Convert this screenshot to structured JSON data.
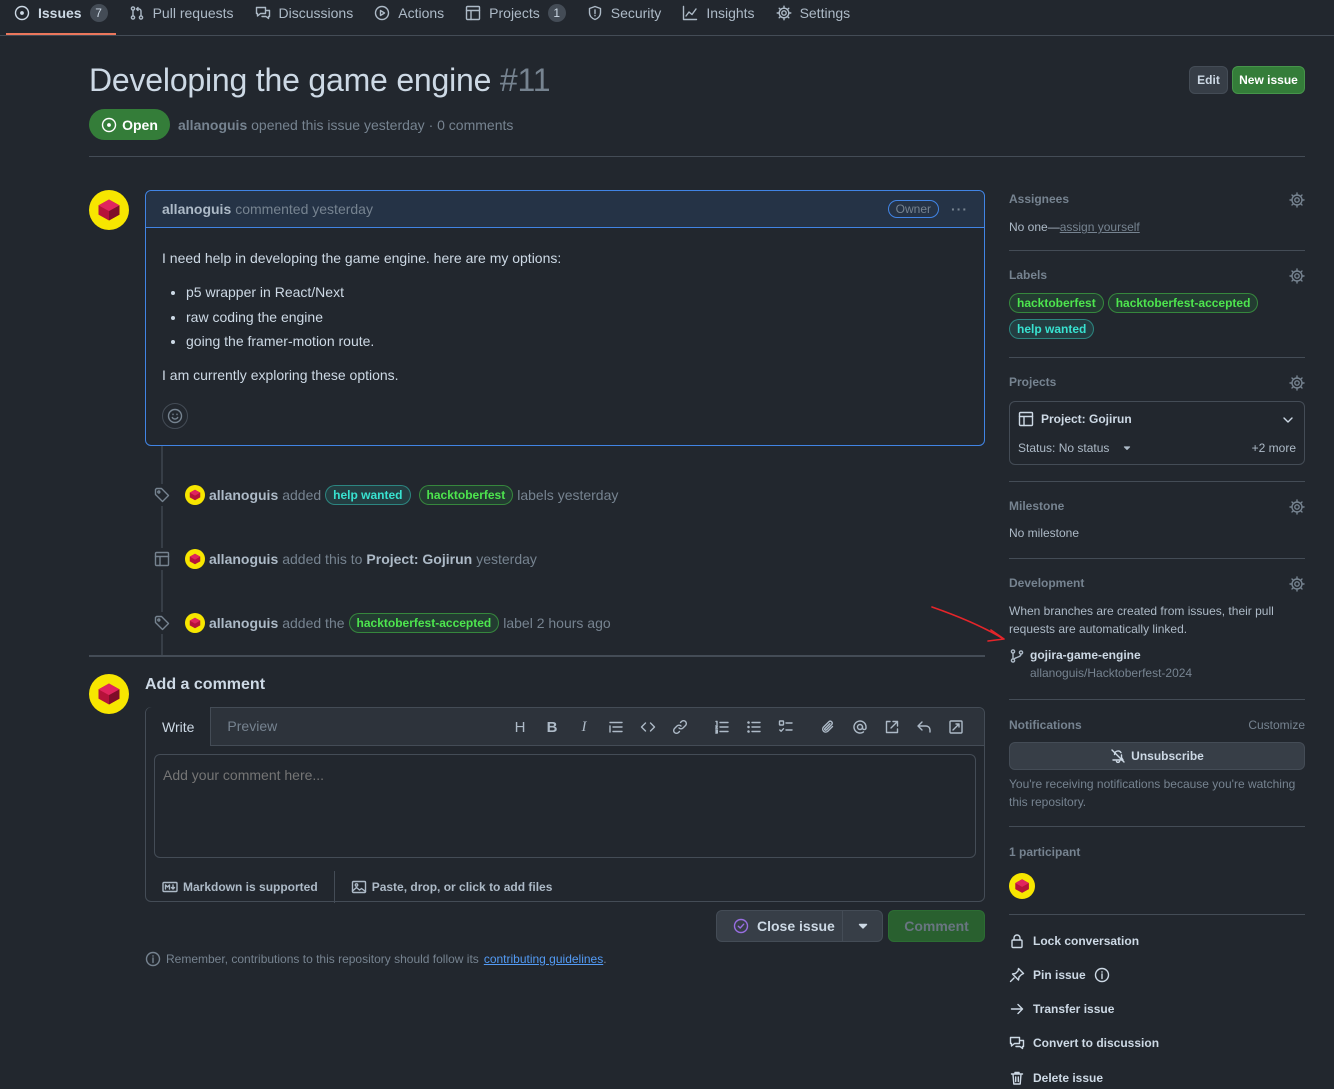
{
  "nav": [
    {
      "label": "Issues",
      "count": "7"
    },
    {
      "label": "Pull requests"
    },
    {
      "label": "Discussions"
    },
    {
      "label": "Actions"
    },
    {
      "label": "Projects",
      "count": "1"
    },
    {
      "label": "Security"
    },
    {
      "label": "Insights"
    },
    {
      "label": "Settings"
    }
  ],
  "issue": {
    "title": "Developing the game engine",
    "number": "#11",
    "state": "Open",
    "author": "allanoguis",
    "meta_text": "opened this issue yesterday · 0 comments",
    "edit_label": "Edit",
    "new_label": "New issue"
  },
  "comment": {
    "author": "allanoguis",
    "action": "commented yesterday",
    "badge": "Owner",
    "intro": "I need help in developing the game engine. here are my options:",
    "options": [
      "p5 wrapper in React/Next",
      "raw coding the engine",
      "going the framer-motion route."
    ],
    "outro": "I am currently exploring these options."
  },
  "timeline": {
    "e1": {
      "actor": "allanoguis",
      "verb": "added",
      "label_a": "help wanted",
      "label_b": "hacktoberfest",
      "tail": "labels yesterday"
    },
    "e2": {
      "actor": "allanoguis",
      "verb": "added this to",
      "project": "Project: Gojirun",
      "tail": "yesterday"
    },
    "e3": {
      "actor": "allanoguis",
      "verb": "added the",
      "label": "hacktoberfest-accepted",
      "tail": "label 2 hours ago"
    }
  },
  "composer": {
    "title": "Add a comment",
    "tab_write": "Write",
    "tab_preview": "Preview",
    "placeholder": "Add your comment here...",
    "markdown": "Markdown is supported",
    "files": "Paste, drop, or click to add files",
    "close_label": "Close issue",
    "comment_label": "Comment",
    "remember_pre": "Remember, contributions to this repository should follow its",
    "remember_link": "contributing guidelines",
    "remember_post": "."
  },
  "sidebar": {
    "assignees": {
      "heading": "Assignees",
      "value": "No one—",
      "link": "assign yourself"
    },
    "labels": {
      "heading": "Labels",
      "items": [
        "hacktoberfest",
        "hacktoberfest-accepted",
        "help wanted"
      ]
    },
    "projects": {
      "heading": "Projects",
      "name": "Project: Gojirun",
      "status": "Status: No status",
      "more": "+2 more"
    },
    "milestone": {
      "heading": "Milestone",
      "value": "No milestone"
    },
    "development": {
      "heading": "Development",
      "desc": "When branches are created from issues, their pull requests are automatically linked.",
      "branch": "gojira-game-engine",
      "repo": "allanoguis/Hacktoberfest-2024"
    },
    "notifications": {
      "heading": "Notifications",
      "customize": "Customize",
      "unsubscribe": "Unsubscribe",
      "desc": "You're receiving notifications because you're watching this repository."
    },
    "participants": {
      "heading": "1 participant"
    },
    "actions": {
      "lock": "Lock conversation",
      "pin": "Pin issue",
      "transfer": "Transfer issue",
      "convert": "Convert to discussion",
      "delete": "Delete issue"
    }
  },
  "colors": {
    "accent_green": "#347d39",
    "link_blue": "#539bf5",
    "highlight_border": "#4184e4",
    "annotation_arrow": "#e5252a"
  },
  "icons": [
    "issue-opened-icon",
    "git-pull-request-icon",
    "comment-discussion-icon",
    "play-icon",
    "table-icon",
    "shield-icon",
    "graph-icon",
    "gear-icon",
    "tag-icon",
    "smiley-icon",
    "git-branch-icon",
    "bell-slash-icon",
    "lock-icon",
    "pin-icon",
    "arrow-right-icon",
    "comment-icon",
    "trash-icon",
    "info-icon",
    "image-icon",
    "markdown-icon",
    "triangle-down-icon",
    "chevron-down-icon"
  ]
}
